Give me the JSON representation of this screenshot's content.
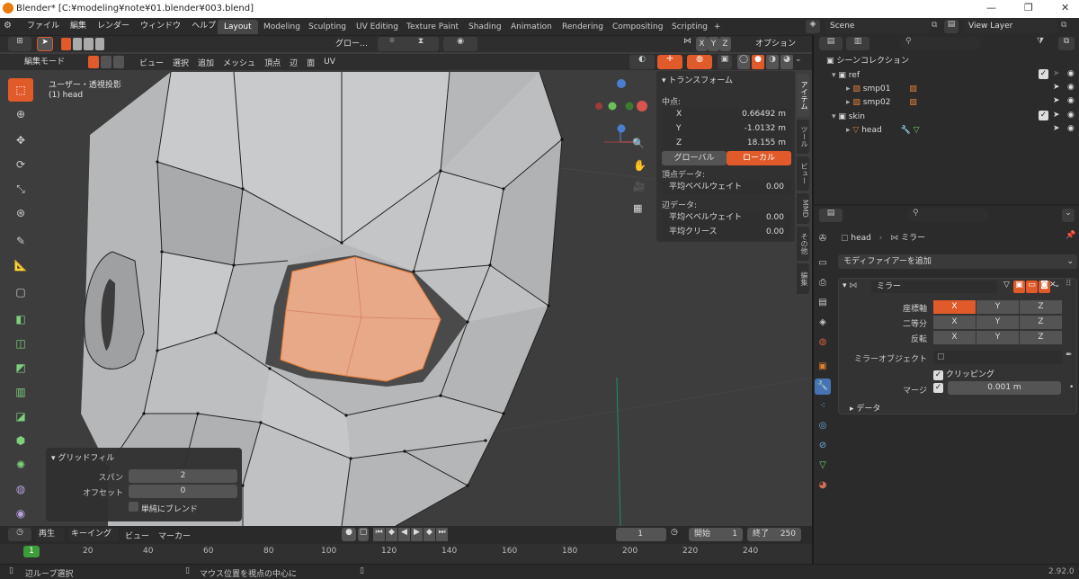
{
  "window": {
    "title": "Blender* [C:¥modeling¥note¥01.blender¥003.blend]",
    "min": "—",
    "max": "❐",
    "close": "✕"
  },
  "menu": [
    "ファイル",
    "編集",
    "レンダー",
    "ウィンドウ",
    "ヘルプ"
  ],
  "workspaces": [
    "Layout",
    "Modeling",
    "Sculpting",
    "UV Editing",
    "Texture Paint",
    "Shading",
    "Animation",
    "Rendering",
    "Compositing",
    "Scripting",
    "+"
  ],
  "scene": "Scene",
  "viewlayer": "View Layer",
  "viewport": {
    "orientation": "グロー…",
    "options": "オプション",
    "mode": "編集モード",
    "menus": [
      "ビュー",
      "選択",
      "追加",
      "メッシュ",
      "頂点",
      "辺",
      "面",
      "UV"
    ],
    "info_line1": "ユーザー・透視投影",
    "info_line2": "(1) head",
    "axes": [
      "X",
      "Y",
      "Z"
    ]
  },
  "npanel": {
    "title": "トランスフォーム",
    "median": "中点:",
    "x_label": "X",
    "x": "0.66492 m",
    "y_label": "Y",
    "y": "-1.0132 m",
    "z_label": "Z",
    "z": "18.155 m",
    "global": "グローバル",
    "local": "ローカル",
    "vertex_data": "頂点データ:",
    "vertex_bevel": "平均ベベルウェイト",
    "vertex_bevel_val": "0.00",
    "edge_data": "辺データ:",
    "edge_bevel": "平均ベベルウェイト",
    "edge_bevel_val": "0.00",
    "edge_crease": "平均クリース",
    "edge_crease_val": "0.00",
    "tabs": [
      "アイテム",
      "ツール",
      "ビュー",
      "MMD",
      "その他",
      "編集"
    ]
  },
  "gridfill": {
    "title": "グリッドフィル",
    "span_label": "スパン",
    "span": "2",
    "offset_label": "オフセット",
    "offset": "0",
    "simple_blend": "単純にブレンド"
  },
  "timeline": {
    "play": "再生",
    "keying": "キーイング",
    "view": "ビュー",
    "marker": "マーカー",
    "current": "1",
    "start_label": "開始",
    "start": "1",
    "end_label": "終了",
    "end": "250",
    "ticks": [
      "1",
      "20",
      "40",
      "60",
      "80",
      "100",
      "120",
      "140",
      "160",
      "180",
      "200",
      "220",
      "240"
    ]
  },
  "status": {
    "left": "辺ループ選択",
    "mid": "マウス位置を視点の中心に",
    "version": "2.92.0"
  },
  "outliner": {
    "collection": "シーンコレクション",
    "items": [
      "ref",
      "smp01",
      "smp02",
      "skin",
      "head"
    ]
  },
  "properties": {
    "object": "head",
    "modifier_path": "ミラー",
    "add_modifier": "モディファイアーを追加",
    "mod_name": "ミラー",
    "axis_label": "座標軸",
    "bisect_label": "二等分",
    "flip_label": "反転",
    "x": "X",
    "y": "Y",
    "z": "Z",
    "mirror_object": "ミラーオブジェクト",
    "clipping": "クリッピング",
    "merge_label": "マージ",
    "merge": "0.001 m",
    "data": "データ"
  },
  "colors": {
    "accent": "#e05a2a",
    "selection_face": "#e8a989",
    "bg_viewport": "#3c3c3c"
  }
}
